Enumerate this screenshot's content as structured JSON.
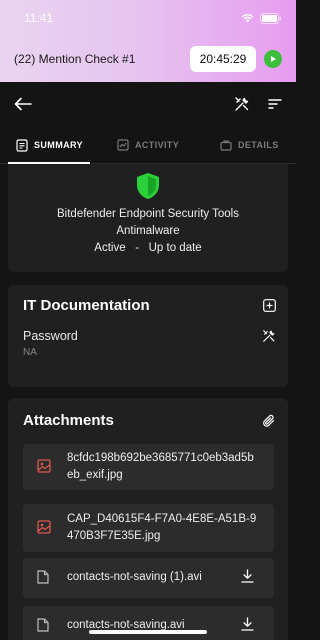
{
  "status": {
    "time": "11:41"
  },
  "timer": {
    "title": "(22) Mention Check #1",
    "elapsed": "20:45:29"
  },
  "tabs": [
    {
      "label": "SUMMARY"
    },
    {
      "label": "ACTIVITY"
    },
    {
      "label": "DETAILS"
    }
  ],
  "product": {
    "name": "Bitdefender Endpoint Security Tools",
    "type": "Antimalware",
    "status_line": "Active   -   Up to date"
  },
  "it_documentation": {
    "title": "IT Documentation",
    "field_label": "Password",
    "field_value": "NA"
  },
  "attachments": {
    "title": "Attachments",
    "items": [
      {
        "name": "8cfdc198b692be3685771c0eb3ad5beb_exif.jpg",
        "icon": "image-icon"
      },
      {
        "name": "CAP_D40615F4-F7A0-4E8E-A51B-9470B3F7E35E.jpg",
        "icon": "image-icon"
      },
      {
        "name": "contacts-not-saving (1).avi",
        "icon": "file-icon"
      },
      {
        "name": "contacts-not-saving.avi",
        "icon": "file-icon"
      }
    ]
  },
  "colors": {
    "accent_green": "#2bd13a",
    "image_icon_red": "#e05a4f",
    "play_green": "#3dbd3d"
  }
}
